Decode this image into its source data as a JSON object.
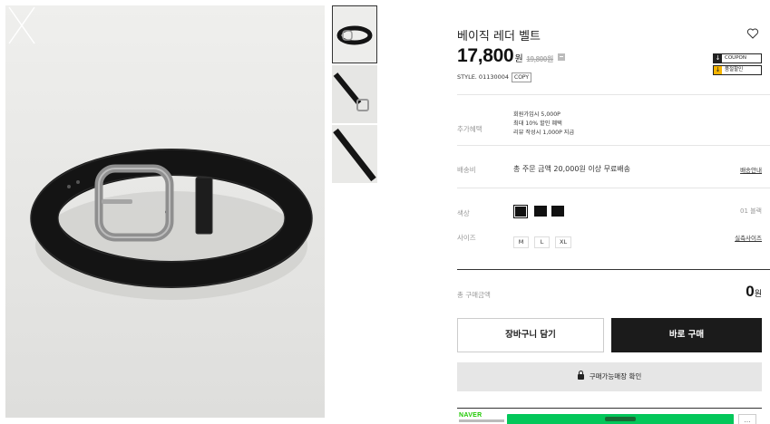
{
  "product": {
    "title": "베이직 레더 벨트",
    "price": "17,800",
    "price_unit": "원",
    "original_price": "19,800원",
    "style_code": "STYLE. 01130004",
    "copy_label": "COPY"
  },
  "coupons": [
    {
      "label": "COUPON",
      "icon": "download-icon"
    },
    {
      "label": "품절할인",
      "icon": "download-icon"
    }
  ],
  "benefits": {
    "label": "추가혜택",
    "lines": [
      "회원가입시 5,000P",
      "최대 10% 할인 혜택",
      "리뷰 작성시 1,000P 지급"
    ]
  },
  "shipping": {
    "label": "배송비",
    "text": "총 주문 금액 20,000원 이상 무료배송",
    "link": "배송안내"
  },
  "color": {
    "label": "색상",
    "swatch_count": 3,
    "selected_index": 0,
    "swatch_color": "#111111",
    "value": "01 블랙"
  },
  "size": {
    "label": "사이즈",
    "options": [
      "M",
      "L",
      "XL"
    ],
    "link": "실측사이즈"
  },
  "total": {
    "label": "총 구매금액",
    "value": "0",
    "unit": "원"
  },
  "actions": {
    "cart": "장바구니 담기",
    "buy": "바로 구매",
    "store": "구매가능매장 확인"
  },
  "naver": {
    "logo": "NAVER"
  },
  "colors": {
    "buy_bg": "#1b1b1b",
    "store_bg": "#e6e6e6",
    "npay_green": "#03c75a",
    "naver_green": "#1ec800",
    "coupon_yellow": "#f5b400"
  }
}
